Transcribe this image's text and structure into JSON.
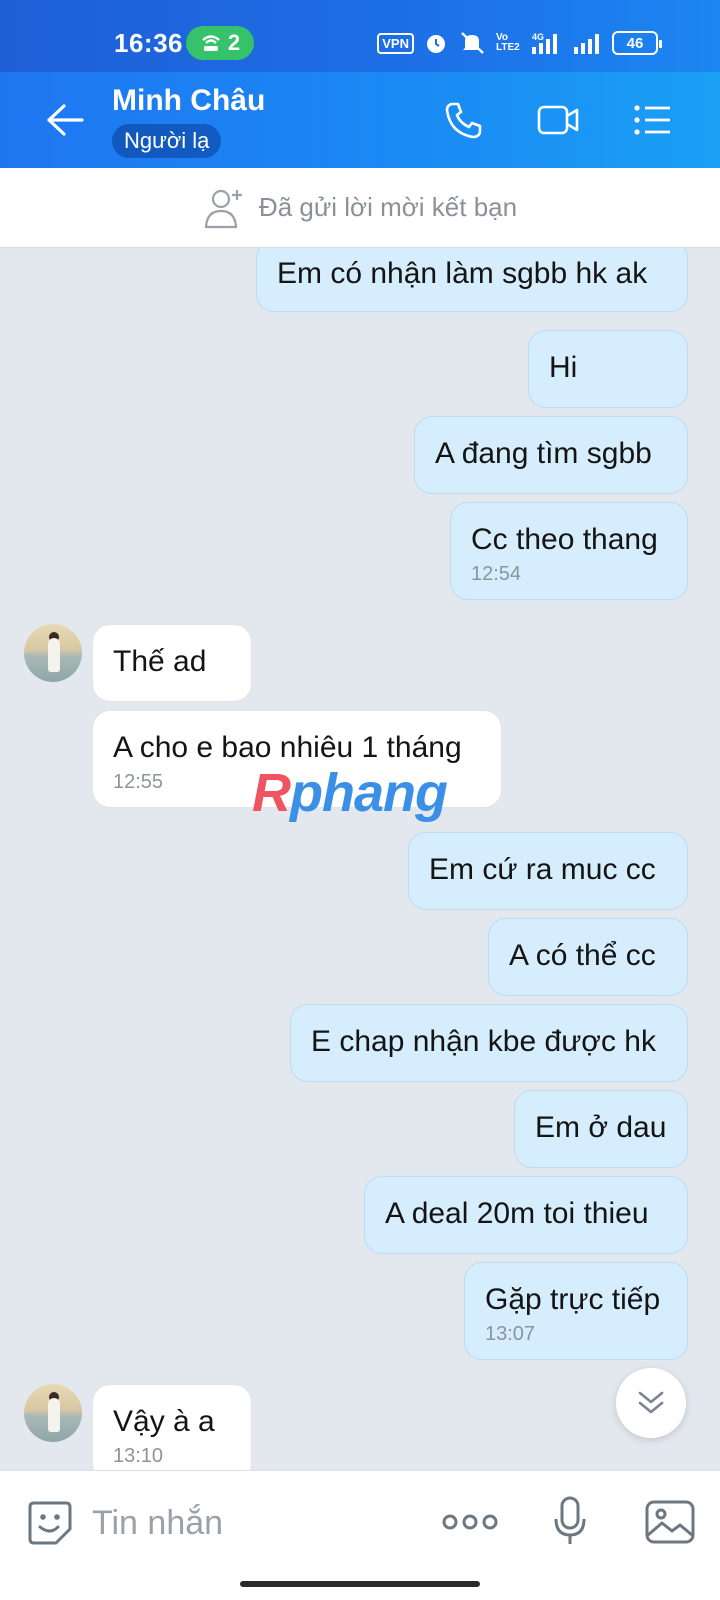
{
  "status_bar": {
    "time": "16:36",
    "hotspot_count": "2",
    "vpn": "VPN",
    "volte": "Vo LTE2",
    "network": "4G",
    "battery": "46"
  },
  "header": {
    "contact_name": "Minh Châu",
    "badge": "Người lạ",
    "accent": "#1a8bf4"
  },
  "friend_request": {
    "text": "Đã gửi lời mời kết bạn"
  },
  "messages": [
    {
      "side": "out",
      "text": "Em có nhận làm sgbb hk ak"
    },
    {
      "side": "out",
      "text": "Hi"
    },
    {
      "side": "out",
      "text": "A đang tìm sgbb"
    },
    {
      "side": "out",
      "text": "Cc theo thang",
      "time": "12:54"
    },
    {
      "side": "in",
      "text": "Thế ad"
    },
    {
      "side": "in",
      "text": "A cho e bao nhiêu 1 tháng",
      "time": "12:55"
    },
    {
      "side": "out",
      "text": "Em cứ ra muc cc"
    },
    {
      "side": "out",
      "text": "A có thể cc"
    },
    {
      "side": "out",
      "text": "E chap nhận kbe được hk"
    },
    {
      "side": "out",
      "text": "Em ở dau"
    },
    {
      "side": "out",
      "text": "A deal 20m toi thieu"
    },
    {
      "side": "out",
      "text": "Gặp trực tiếp",
      "time": "13:07"
    },
    {
      "side": "in",
      "text": "Vậy à a",
      "time": "13:10"
    }
  ],
  "watermark": {
    "part1": "R",
    "part2": "phang"
  },
  "input": {
    "placeholder": "Tin nhắn"
  },
  "icons": {
    "back": "arrow-left-icon",
    "call": "phone-icon",
    "video": "video-camera-icon",
    "menu": "list-menu-icon",
    "emoji": "sticker-emoji-icon",
    "more": "more-dots-icon",
    "mic": "microphone-icon",
    "image": "image-gallery-icon",
    "scroll": "chevron-double-down-icon"
  }
}
